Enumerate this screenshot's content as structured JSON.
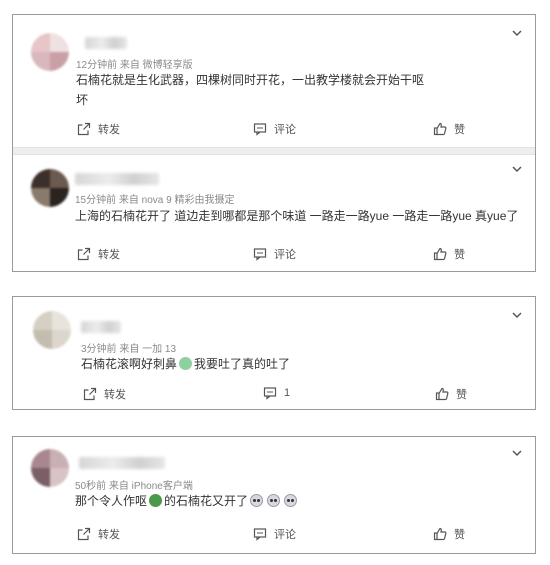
{
  "comments": [
    {
      "meta": "12分钟前  来自 微博轻享版",
      "text1": "石楠花就是生化武器，四棵树同时开花，一出教学楼就会开始干呕",
      "text2": "坏",
      "repost": "转发",
      "comment": "评论",
      "like": "赞"
    },
    {
      "meta": "15分钟前  来自 nova 9 精彩由我摄定",
      "text1": "上海的石楠花开了 道边走到哪都是那个味道 一路走一路yue 一路走一路yue 真yue了",
      "repost": "转发",
      "comment": "评论",
      "like": "赞"
    },
    {
      "meta": "3分钟前  来自 一加 13",
      "text_a": "石楠花滚啊好刺鼻",
      "text_b": "我要吐了真的吐了",
      "repost": "转发",
      "comment": "1",
      "like": "赞"
    },
    {
      "meta": "50秒前  来自 iPhone客户端",
      "text_a": "那个令人作呕",
      "text_b": "的石楠花又开了",
      "repost": "转发",
      "comment": "评论",
      "like": "赞"
    }
  ],
  "icons": {
    "repost": "share-icon",
    "comment": "comment-icon",
    "like": "thumbs-up-icon",
    "menu": "chevron-down-icon"
  },
  "colors": {
    "border": "#9a9a9a",
    "meta_text": "#8a8a8a",
    "body_text": "#333333"
  }
}
